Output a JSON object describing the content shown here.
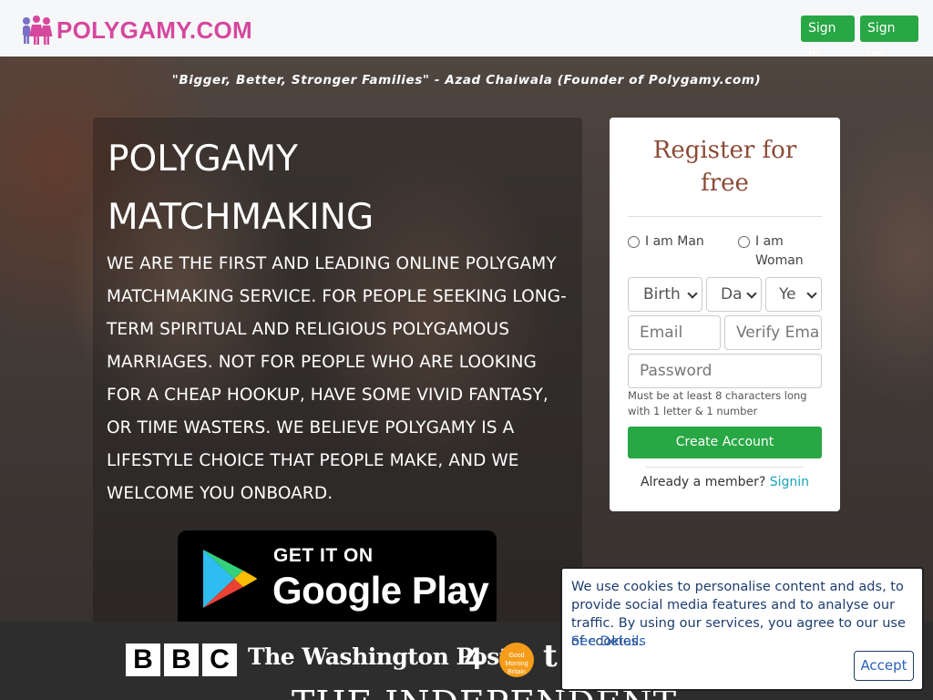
{
  "header": {
    "brand": "POLYGAMY.COM",
    "signin_label": "Sign in",
    "signup_label": "Sign up"
  },
  "hero": {
    "quote": "\"Bigger, Better, Stronger Families\" - Azad Chaiwala (Founder of Polygamy.com)",
    "title": "POLYGAMY MATCHMAKING",
    "description": "WE ARE THE FIRST AND LEADING ONLINE POLYGAMY MATCHMAKING SERVICE. FOR PEOPLE SEEKING LONG-TERM SPIRITUAL AND RELIGIOUS POLYGAMOUS MARRIAGES. NOT FOR PEOPLE WHO ARE LOOKING FOR A CHEAP HOOKUP, HAVE SOME VIVID FANTASY, OR TIME WASTERS. WE BELIEVE POLYGAMY IS A LIFESTYLE CHOICE THAT PEOPLE MAKE, AND WE WELCOME YOU ONBOARD.",
    "store_badge": {
      "line1": "GET IT ON",
      "line2": "Google Play"
    }
  },
  "register": {
    "title": "Register for free",
    "radio_man": "I am Man",
    "radio_woman": "I am Woman",
    "birth_select": "Birth",
    "day_select": "Da",
    "year_select": "Ye",
    "email_placeholder": "Email",
    "verify_email_placeholder": "Verify Ema",
    "password_placeholder": "Password",
    "password_hint": "Must be at least 8 characters long with 1 letter & 1 number",
    "create_button": "Create Account",
    "member_text": "Already a member?",
    "member_link": "Signin"
  },
  "press": {
    "bbc_letters": [
      "B",
      "B",
      "C"
    ],
    "washington_post": "The Washington Post",
    "channel4": "4",
    "gmb": "Good Morning Britain",
    "times_fragment": "t",
    "independent": "THE INDEPENDENT"
  },
  "cookie": {
    "text": "We use cookies to personalise content and ads, to provide social media features and to analyse our traffic. By using our services, you agree to our use of cookies.",
    "link": "See Details",
    "accept_label": "Accept"
  },
  "colors": {
    "brand_pink": "#d6479e",
    "green": "#28a745",
    "link_teal": "#17a2b8",
    "title_brown": "#8b4a35"
  }
}
